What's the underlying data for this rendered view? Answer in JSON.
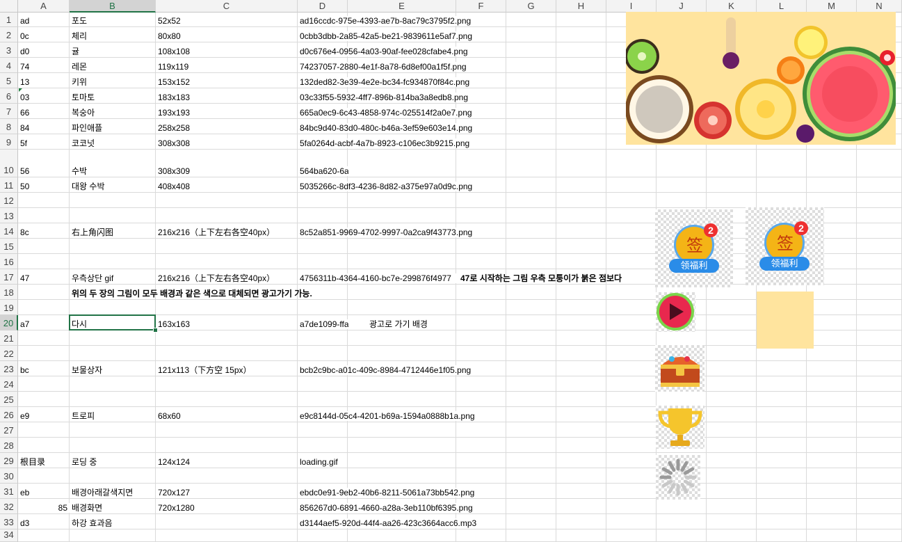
{
  "columns": [
    "A",
    "B",
    "C",
    "D",
    "E",
    "F",
    "G",
    "H",
    "I",
    "J",
    "K",
    "L",
    "M",
    "N"
  ],
  "selected_column": "B",
  "selected_row": "20",
  "rows": [
    "1",
    "2",
    "3",
    "4",
    "5",
    "6",
    "7",
    "8",
    "9",
    "10",
    "11",
    "12",
    "13",
    "14",
    "15",
    "16",
    "17",
    "18",
    "19",
    "20",
    "21",
    "22",
    "23",
    "24",
    "25",
    "26",
    "27",
    "28",
    "29",
    "30",
    "31",
    "32",
    "33",
    "34"
  ],
  "cells": {
    "r1": {
      "a": "ad",
      "b": "포도",
      "c": "52x52",
      "d": "ad16ccdc-975e-4393-ae7b-8ac79c3795f2.png"
    },
    "r2": {
      "a": "0c",
      "b": "체리",
      "c": "80x80",
      "d": "0cbb3dbb-2a85-42a5-be21-9839611e5af7.png"
    },
    "r3": {
      "a": "d0",
      "b": "귤",
      "c": "108x108",
      "d": "d0c676e4-0956-4a03-90af-fee028cfabe4.png"
    },
    "r4": {
      "a": "74",
      "b": "레몬",
      "c": "119x119",
      "d": "74237057-2880-4e1f-8a78-6d8ef00a1f5f.png"
    },
    "r5": {
      "a": "13",
      "b": "키위",
      "c": "153x152",
      "d": "132ded82-3e39-4e2e-bc34-fc934870f84c.png"
    },
    "r6": {
      "a": "03",
      "b": "토마토",
      "c": "183x183",
      "d": "03c33f55-5932-4ff7-896b-814ba3a8edb8.png"
    },
    "r7": {
      "a": "66",
      "b": "복숭아",
      "c": "193x193",
      "d": "665a0ec9-6c43-4858-974c-025514f2a0e7.png"
    },
    "r8": {
      "a": "84",
      "b": "파인애플",
      "c": "258x258",
      "d": "84bc9d40-83d0-480c-b46a-3ef59e603e14.png"
    },
    "r9": {
      "a": "5f",
      "b": "코코넛",
      "c": "308x308",
      "d": "5fa0264d-acbf-4a7b-8923-c106ec3b9215.png"
    },
    "r10": {
      "a": "56",
      "b": "수박",
      "c": "308x309",
      "d": "564ba620-6a"
    },
    "r11": {
      "a": "50",
      "b": "대왕 수박",
      "c": "408x408",
      "d": "5035266c-8df3-4236-8d82-a375e97a0d9c.png"
    },
    "r14": {
      "a": "8c",
      "b": "右上角闪图",
      "c": "216x216（上下左右各空40px）",
      "d": "8c52a851-9969-4702-9997-0a2ca9f43773.png"
    },
    "r17": {
      "a": "47",
      "b": "우측상단 gif",
      "c": "216x216（上下左右各空40px）",
      "d": "4756311b-4364-4160-bc7e-299876f4977",
      "e": "47로 시작하는 그림 우측 모퉁이가 붉은 점보다"
    },
    "r18": {
      "b": "위의 두 장의 그림이 모두 배경과 같은 색으로 대체되면 광고가기 가능."
    },
    "r20": {
      "a": "a7",
      "b": "다시",
      "c": "163x163",
      "d": "a7de1099-ffa",
      "e": "광고로 가기 배경"
    },
    "r23": {
      "a": "bc",
      "b": "보물상자",
      "c": "121x113（下方空 15px）",
      "d": "bcb2c9bc-a01c-409c-8984-4712446e1f05.png"
    },
    "r26": {
      "a": "e9",
      "b": "트로피",
      "c": "68x60",
      "d": "e9c8144d-05c4-4201-b69a-1594a0888b1a.png"
    },
    "r29": {
      "a": "根目录",
      "b": "로딩 중",
      "c": "124x124",
      "d": "loading.gif"
    },
    "r31": {
      "a": "eb",
      "b": "배경아래갈색지면",
      "c": "720x127",
      "d": "ebdc0e91-9eb2-40b6-8211-5061a73bb542.png"
    },
    "r32": {
      "a": "85",
      "b": "배경화면",
      "c": "720x1280",
      "d": "856267d0-6891-4660-a28a-3eb110bf6395.png"
    },
    "r33": {
      "a": "d3",
      "b": "하강 효과음",
      "d": "d3144aef5-920d-44f4-aa26-423c3664acc6.mp3"
    }
  },
  "images": {
    "fruit_preview": "fruit-merge-game-icon",
    "sign_badge_text": "签",
    "sign_badge_count": "2",
    "sign_ribbon_text": "领福利",
    "sign_badge_text_2": "签",
    "sign_badge_count_2": "2",
    "sign_ribbon_text_2": "领福利",
    "play": "play-button-icon",
    "chest": "treasure-chest-icon",
    "trophy": "trophy-icon",
    "loading": "loading-spinner-icon",
    "swatch_color": "#FFE49E"
  }
}
